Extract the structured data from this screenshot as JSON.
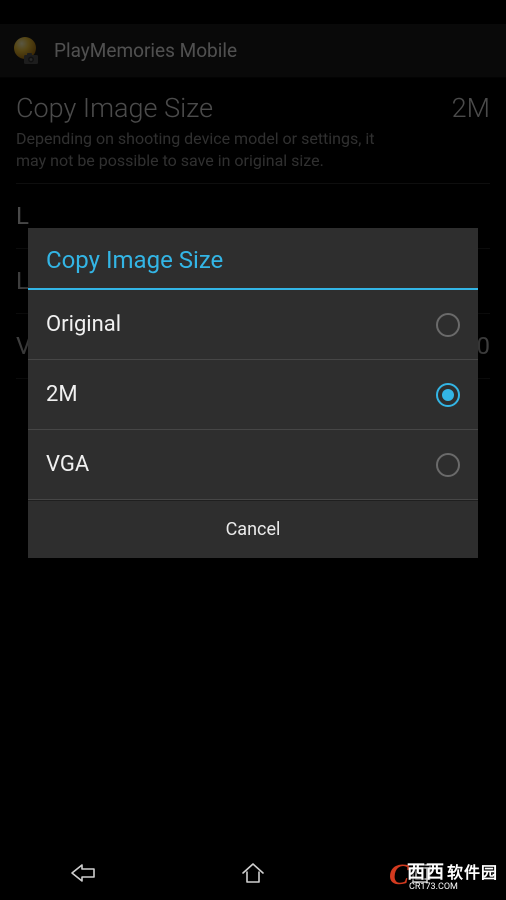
{
  "app": {
    "title": "PlayMemories Mobile"
  },
  "settings": {
    "copy_image_size": {
      "title": "Copy Image Size",
      "value": "2M",
      "description": "Depending on shooting device model or settings, it may not be possible to save in original size."
    },
    "stub_a": "L",
    "stub_b": "L",
    "stub_c_left": "V",
    "stub_c_right": "0"
  },
  "dialog": {
    "title": "Copy Image Size",
    "options": [
      {
        "label": "Original",
        "selected": false
      },
      {
        "label": "2M",
        "selected": true
      },
      {
        "label": "VGA",
        "selected": false
      }
    ],
    "cancel": "Cancel"
  },
  "watermark": {
    "initial": "C",
    "main": "西西",
    "sub": "CR173.COM",
    "suffix": "软件园"
  }
}
